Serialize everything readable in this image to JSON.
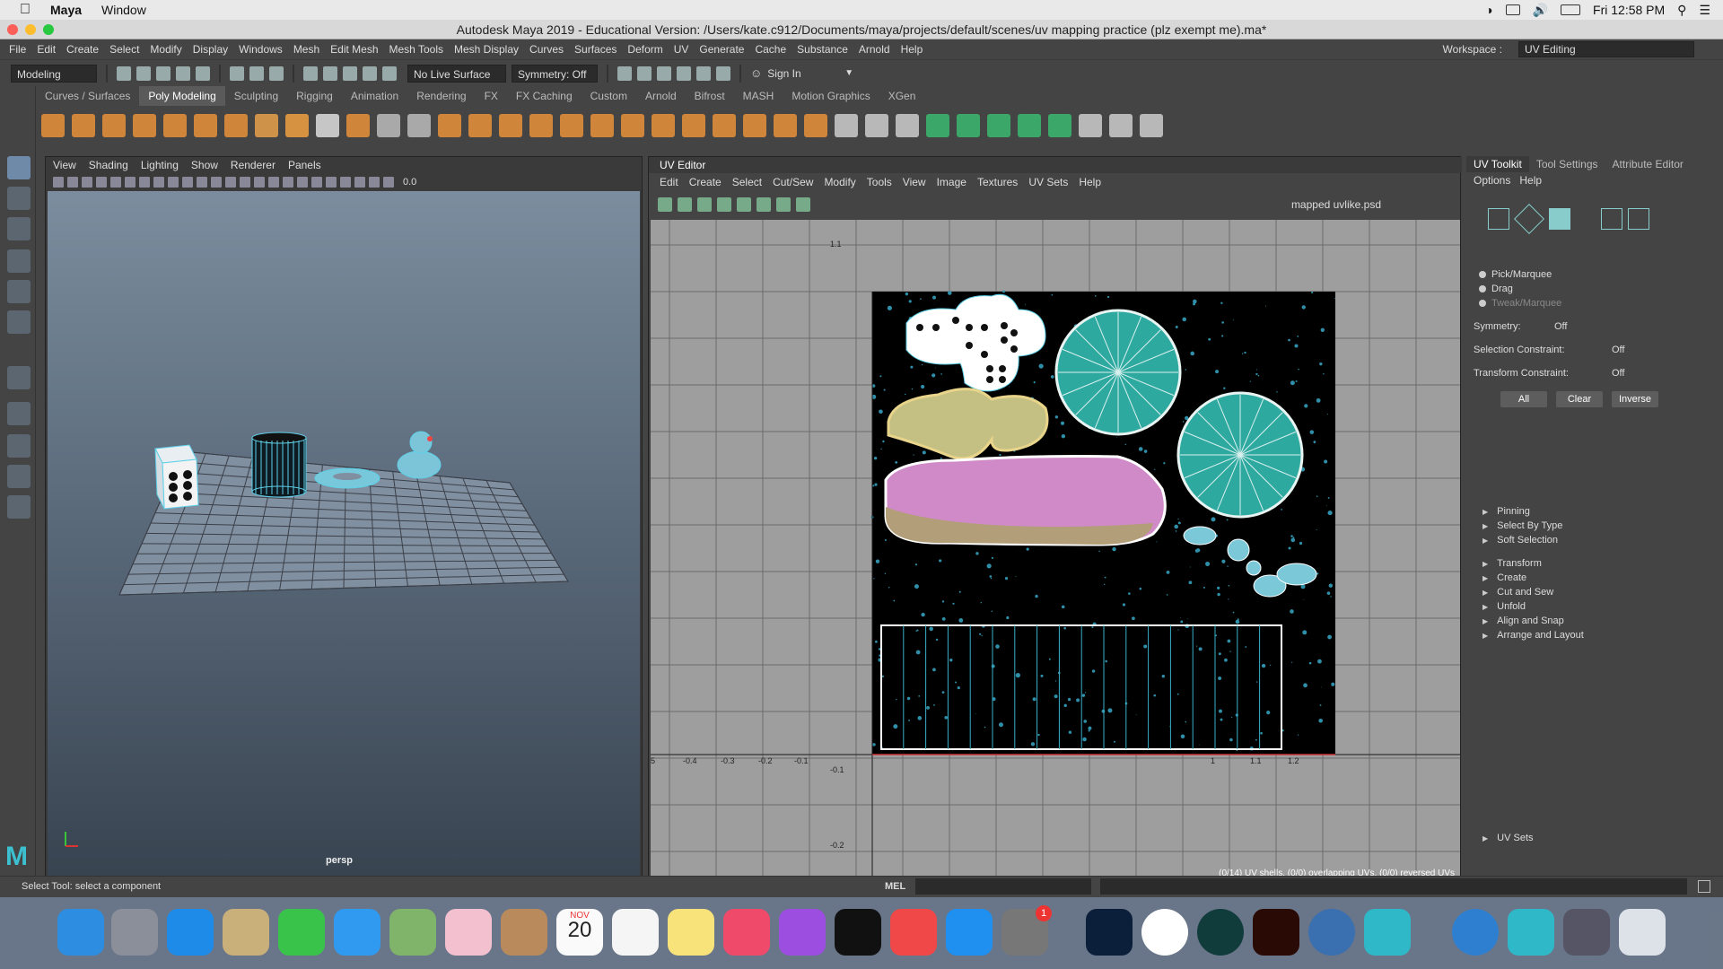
{
  "menubar": {
    "app": "Maya",
    "window": "Window",
    "clock": "Fri 12:58 PM"
  },
  "window": {
    "title": "Autodesk Maya 2019 - Educational Version: /Users/kate.c912/Documents/maya/projects/default/scenes/uv mapping practice (plz exempt me).ma*"
  },
  "maya_menu": [
    "File",
    "Edit",
    "Create",
    "Select",
    "Modify",
    "Display",
    "Windows",
    "Mesh",
    "Edit Mesh",
    "Mesh Tools",
    "Mesh Display",
    "Curves",
    "Surfaces",
    "Deform",
    "UV",
    "Generate",
    "Cache",
    "Substance",
    "Arnold",
    "Help"
  ],
  "workspace": {
    "label": "Workspace :",
    "value": "UV Editing"
  },
  "status_line": {
    "mode": "Modeling",
    "live_surface": "No Live Surface",
    "symmetry": "Symmetry: Off",
    "sign_in": "Sign In"
  },
  "shelf_tabs": [
    "Curves / Surfaces",
    "Poly Modeling",
    "Sculpting",
    "Rigging",
    "Animation",
    "Rendering",
    "FX",
    "FX Caching",
    "Custom",
    "Arnold",
    "Bifrost",
    "MASH",
    "Motion Graphics",
    "XGen"
  ],
  "viewport": {
    "menu": [
      "View",
      "Shading",
      "Lighting",
      "Show",
      "Renderer",
      "Panels"
    ],
    "camera": "persp",
    "value_readout": "0.0"
  },
  "uv_editor": {
    "title": "UV Editor",
    "menu": [
      "Edit",
      "Create",
      "Select",
      "Cut/Sew",
      "Modify",
      "Tools",
      "View",
      "Image",
      "Textures",
      "UV Sets",
      "Help"
    ],
    "image_name": "mapped uvlike.psd",
    "axis_labels_x": [
      "5",
      "-0.4",
      "-0.3",
      "-0.2",
      "-0.1",
      "1",
      "1.1",
      "1.2"
    ],
    "axis_labels_y": [
      "1.1",
      "-0.1",
      "-0.2"
    ],
    "status": "(0/14) UV shells, (0/0) overlapping UVs, (0/0) reversed UVs"
  },
  "right_panel": {
    "tabs": [
      "UV Toolkit",
      "Tool Settings",
      "Attribute Editor"
    ],
    "menu": [
      "Options",
      "Help"
    ],
    "radios": [
      "Pick/Marquee",
      "Drag",
      "Tweak/Marquee"
    ],
    "symmetry": {
      "label": "Symmetry:",
      "value": "Off"
    },
    "selection_constraint": {
      "label": "Selection Constraint:",
      "value": "Off"
    },
    "transform_constraint": {
      "label": "Transform Constraint:",
      "value": "Off"
    },
    "buttons": [
      "All",
      "Clear",
      "Inverse"
    ],
    "sections": [
      "Pinning",
      "Select By Type",
      "Soft Selection",
      "Transform",
      "Create",
      "Cut and Sew",
      "Unfold",
      "Align and Snap",
      "Arrange and Layout"
    ],
    "uv_sets": "UV Sets"
  },
  "help_line": {
    "text": "Select Tool: select a component",
    "mel": "MEL"
  },
  "dock": {
    "badge": "1",
    "calendar_month": "NOV",
    "calendar_day": "20"
  },
  "colors": {
    "accent": "#5ab0c8",
    "uv_blue": "#3aa6c4",
    "uv_teal": "#2ea9a0"
  }
}
